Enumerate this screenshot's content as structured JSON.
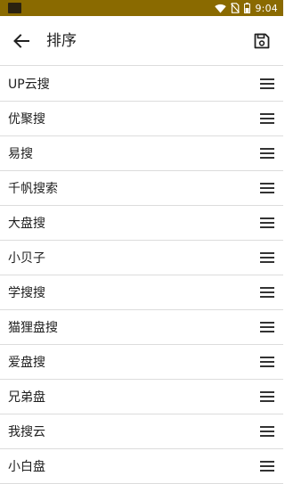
{
  "status_bar": {
    "time": "9:04",
    "icons": [
      "wifi-icon",
      "no-sim-icon",
      "battery-icon"
    ]
  },
  "header": {
    "back_icon": "arrow-left-icon",
    "title": "排序",
    "save_icon": "save-icon"
  },
  "list": {
    "items": [
      {
        "label": "UP云搜"
      },
      {
        "label": "优聚搜"
      },
      {
        "label": "易搜"
      },
      {
        "label": "千帆搜索"
      },
      {
        "label": "大盘搜"
      },
      {
        "label": "小贝子"
      },
      {
        "label": "学搜搜"
      },
      {
        "label": "猫狸盘搜"
      },
      {
        "label": "爱盘搜"
      },
      {
        "label": "兄弟盘"
      },
      {
        "label": "我搜云"
      },
      {
        "label": "小白盘"
      }
    ],
    "handle_icon": "drag-handle-icon"
  },
  "colors": {
    "status_bar": "#8a6a00",
    "divider": "#dcdcdc",
    "text": "#212121"
  }
}
